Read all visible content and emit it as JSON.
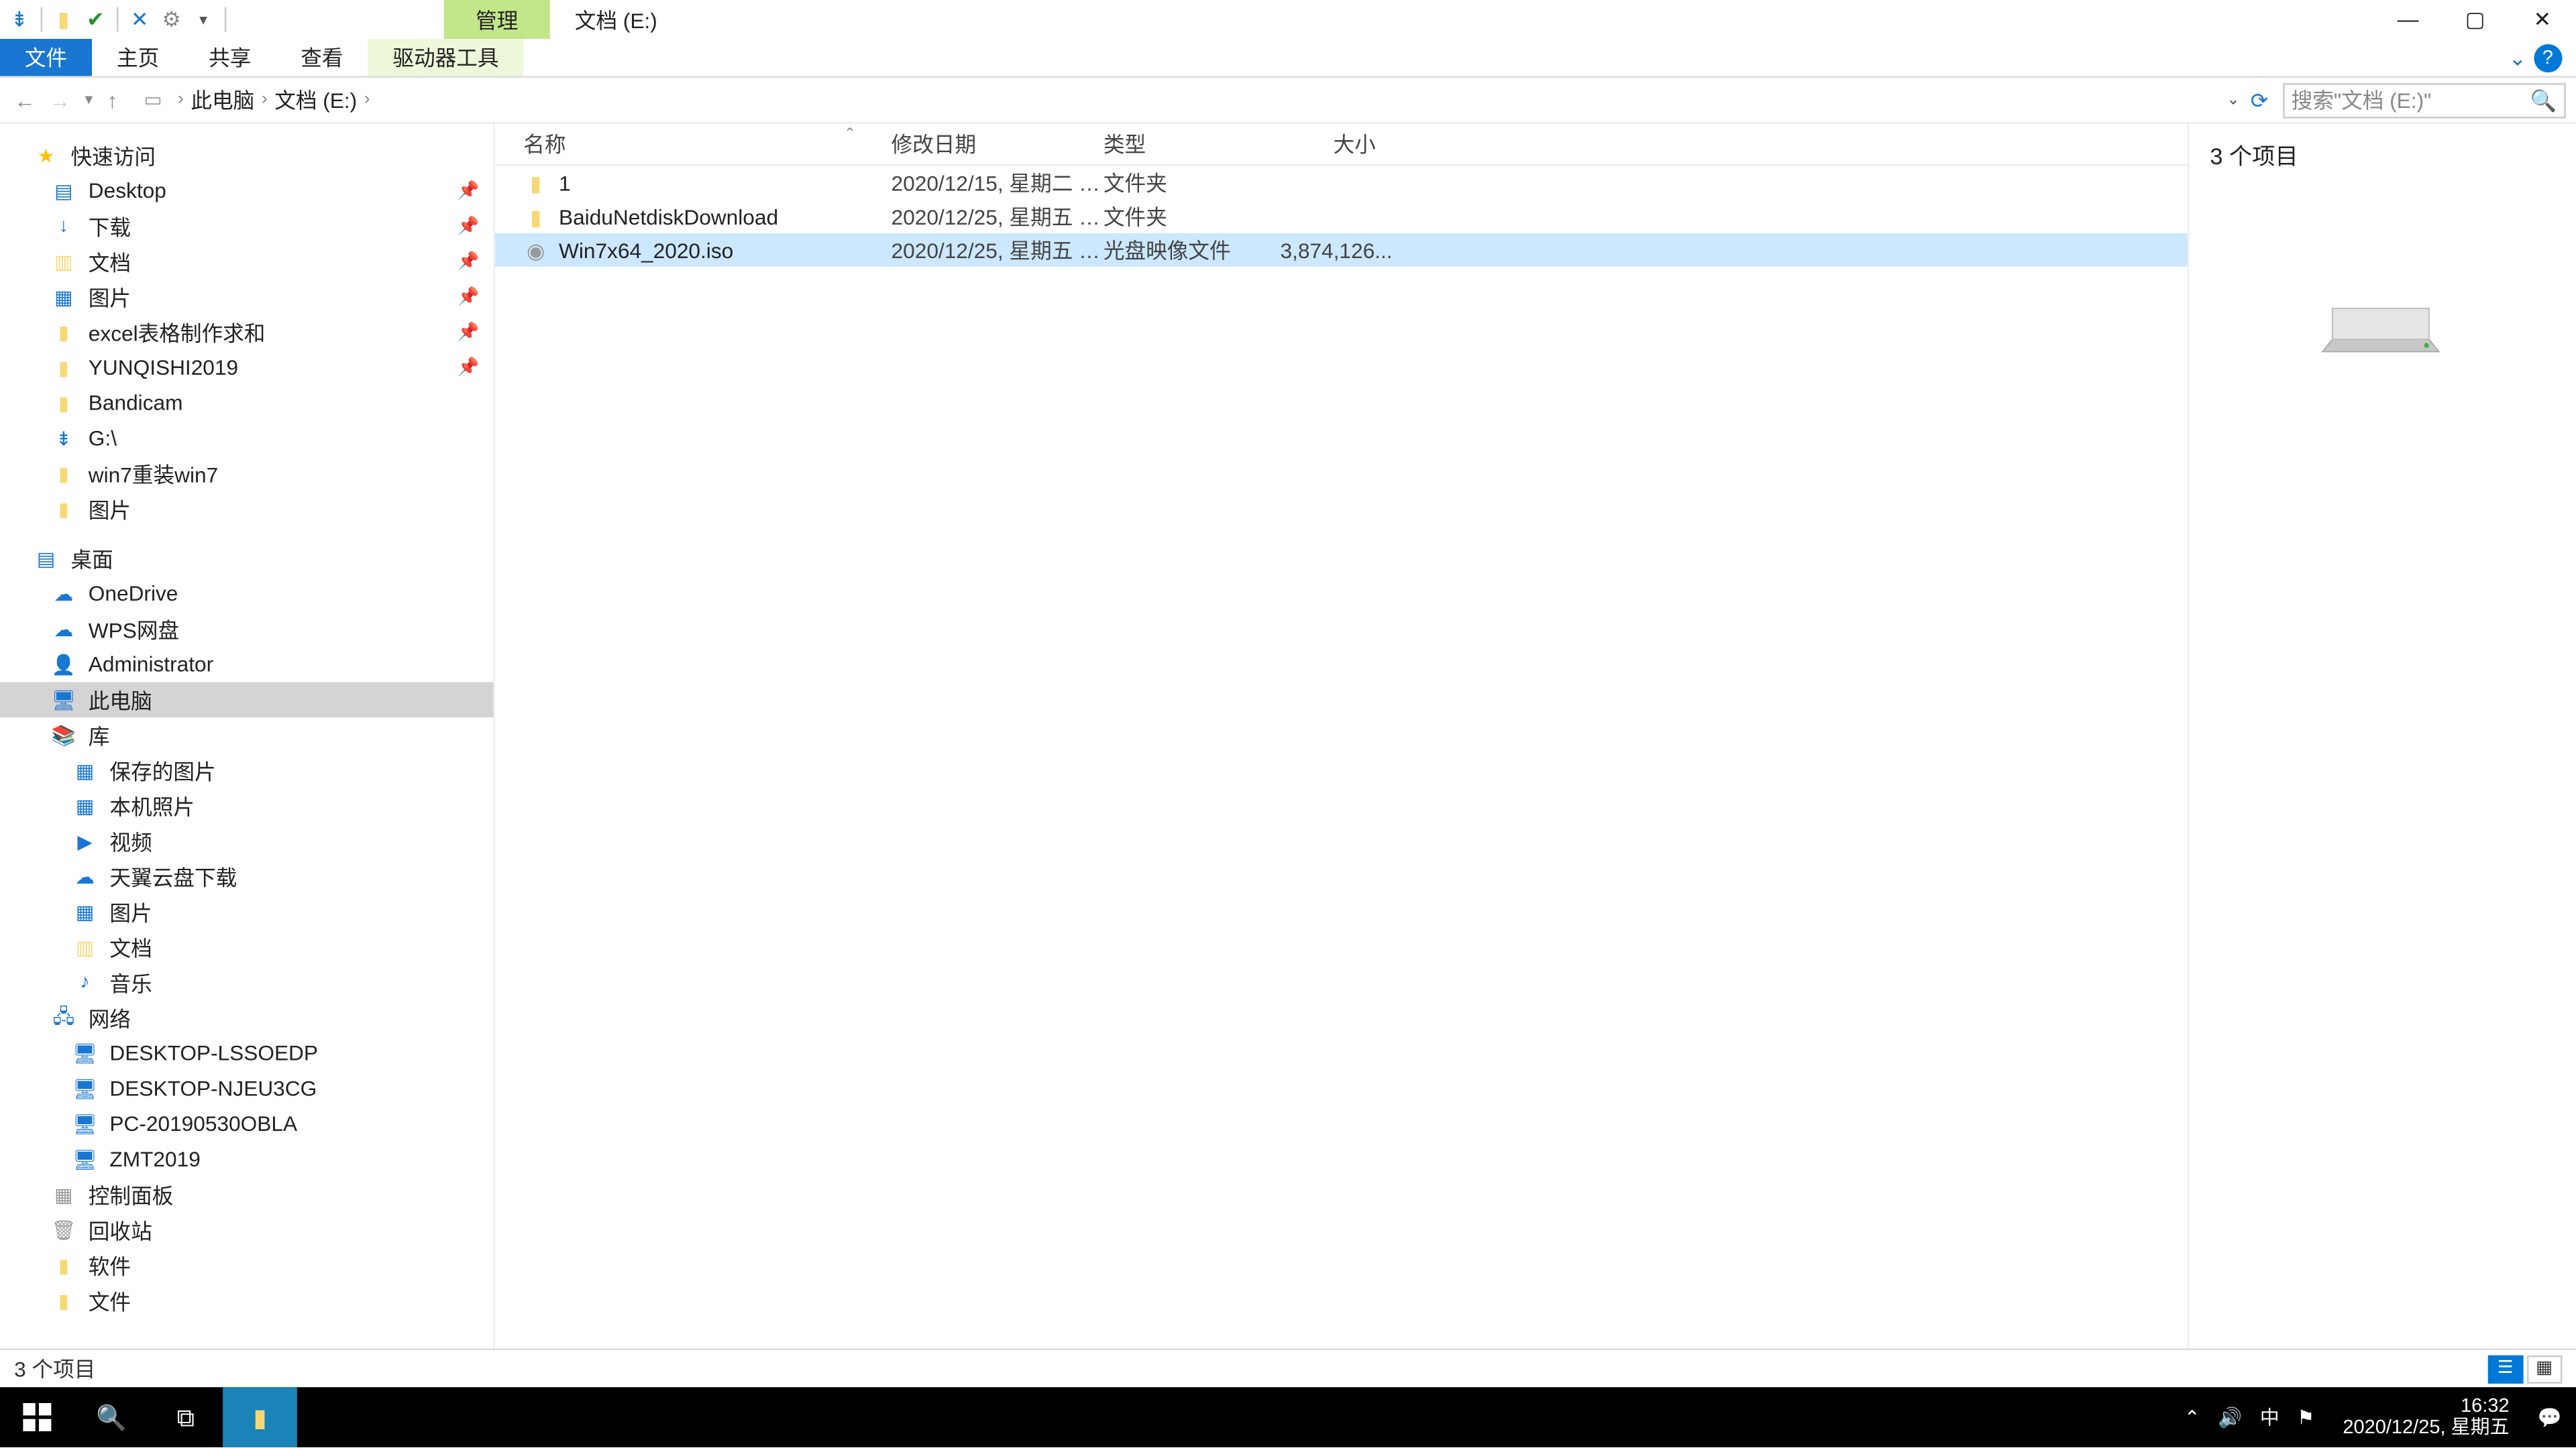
{
  "titlebar": {
    "manage_label": "管理",
    "path_label": "文档 (E:)"
  },
  "ribbon": {
    "file": "文件",
    "home": "主页",
    "share": "共享",
    "view": "查看",
    "drive": "驱动器工具"
  },
  "address": {
    "seg1": "此电脑",
    "seg2": "文档 (E:)"
  },
  "search": {
    "placeholder": "搜索\"文档 (E:)\""
  },
  "nav": {
    "quick": "快速访问",
    "desktop": "Desktop",
    "downloads": "下载",
    "docs": "文档",
    "pictures": "图片",
    "excel": "excel表格制作求和",
    "yunqi": "YUNQISHI2019",
    "bandicam": "Bandicam",
    "gdrive": "G:\\",
    "win7r": "win7重装win7",
    "pictures2": "图片",
    "desktop2": "桌面",
    "onedrive": "OneDrive",
    "wps": "WPS网盘",
    "admin": "Administrator",
    "thispc": "此电脑",
    "libs": "库",
    "savedpics": "保存的图片",
    "camroll": "本机照片",
    "video": "视频",
    "tianyi": "天翼云盘下载",
    "pics3": "图片",
    "docs2": "文档",
    "music": "音乐",
    "network": "网络",
    "d1": "DESKTOP-LSSOEDP",
    "d2": "DESKTOP-NJEU3CG",
    "d3": "PC-20190530OBLA",
    "d4": "ZMT2019",
    "ctrl": "控制面板",
    "recycle": "回收站",
    "soft": "软件",
    "file": "文件"
  },
  "columns": {
    "name": "名称",
    "date": "修改日期",
    "type": "类型",
    "size": "大小"
  },
  "files": [
    {
      "name": "1",
      "date": "2020/12/15, 星期二 1...",
      "type": "文件夹",
      "size": "",
      "icon": "folder"
    },
    {
      "name": "BaiduNetdiskDownload",
      "date": "2020/12/25, 星期五 1...",
      "type": "文件夹",
      "size": "",
      "icon": "folder"
    },
    {
      "name": "Win7x64_2020.iso",
      "date": "2020/12/25, 星期五 1...",
      "type": "光盘映像文件",
      "size": "3,874,126...",
      "icon": "iso"
    }
  ],
  "preview": {
    "count": "3 个项目"
  },
  "status": {
    "count": "3 个项目"
  },
  "taskbar": {
    "time": "16:32",
    "date": "2020/12/25, 星期五",
    "ime": "中"
  }
}
